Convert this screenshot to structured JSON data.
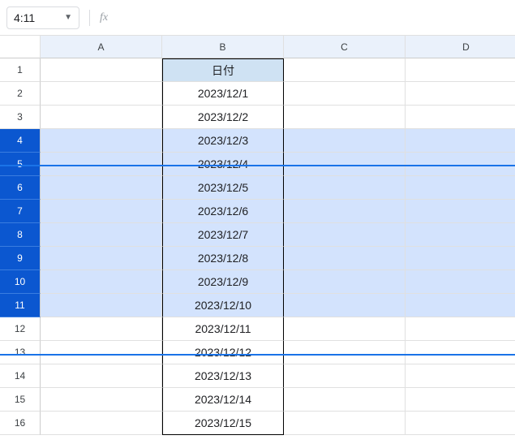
{
  "toolbar": {
    "namebox_value": "4:11",
    "fx_label": "fx",
    "formula_value": ""
  },
  "columns": [
    "A",
    "B",
    "C",
    "D"
  ],
  "rows": {
    "count": 16,
    "selected_start": 4,
    "selected_end": 11
  },
  "data": {
    "B1": "日付",
    "B2": "2023/12/1",
    "B3": "2023/12/2",
    "B4": "2023/12/3",
    "B5": "2023/12/4",
    "B6": "2023/12/5",
    "B7": "2023/12/6",
    "B8": "2023/12/7",
    "B9": "2023/12/8",
    "B10": "2023/12/9",
    "B11": "2023/12/10",
    "B12": "2023/12/11",
    "B13": "2023/12/12",
    "B14": "2023/12/13",
    "B15": "2023/12/14",
    "B16": "2023/12/15"
  }
}
